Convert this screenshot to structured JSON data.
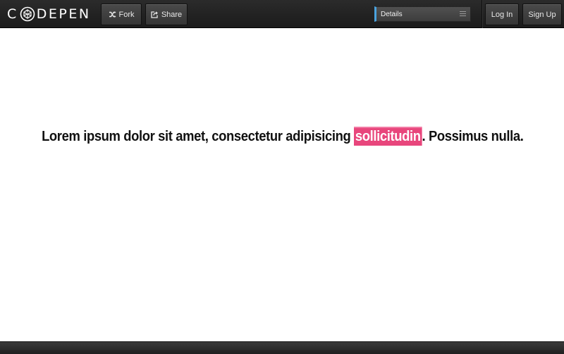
{
  "header": {
    "logo": {
      "before": "C",
      "after": "DEPEN"
    },
    "buttons": {
      "fork": "Fork",
      "share": "Share",
      "login": "Log In",
      "signup": "Sign Up"
    },
    "details": {
      "label": "Details"
    }
  },
  "main": {
    "text_before": "Lorem ipsum dolor sit amet, consectetur adipisicing ",
    "highlight": "sollicitudin",
    "text_after": ". Possimus nulla."
  },
  "colors": {
    "highlight_bg": "#e8467c",
    "header_bg": "#1f1f1f",
    "accent": "#4aa3df"
  },
  "icons": [
    "codepen-logo-icon",
    "fork-icon",
    "share-icon",
    "menu-icon"
  ]
}
